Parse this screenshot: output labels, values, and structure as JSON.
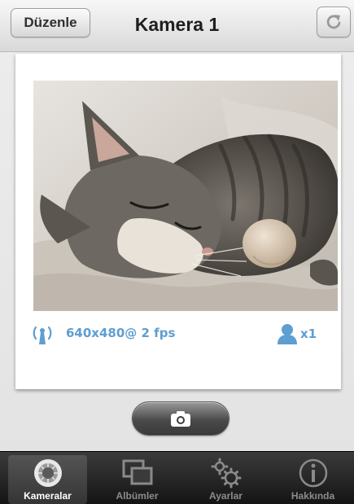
{
  "navbar": {
    "edit_label": "Düzenle",
    "title": "Kamera 1",
    "refresh_icon": "refresh-icon"
  },
  "camera": {
    "resolution": "640x480@ 2 fps",
    "viewers": "x1",
    "signal_icon": "signal-icon",
    "viewer_icon": "person-icon"
  },
  "snapshot": {
    "icon": "camera-icon"
  },
  "tabs": [
    {
      "label": "Kameralar",
      "icon": "camera-lens-icon",
      "active": true
    },
    {
      "label": "Albümler",
      "icon": "albums-icon",
      "active": false
    },
    {
      "label": "Ayarlar",
      "icon": "gears-icon",
      "active": false
    },
    {
      "label": "Hakkında",
      "icon": "info-icon",
      "active": false
    }
  ],
  "colors": {
    "accent": "#5f9ed0",
    "tabbar": "#1e1e1e"
  }
}
